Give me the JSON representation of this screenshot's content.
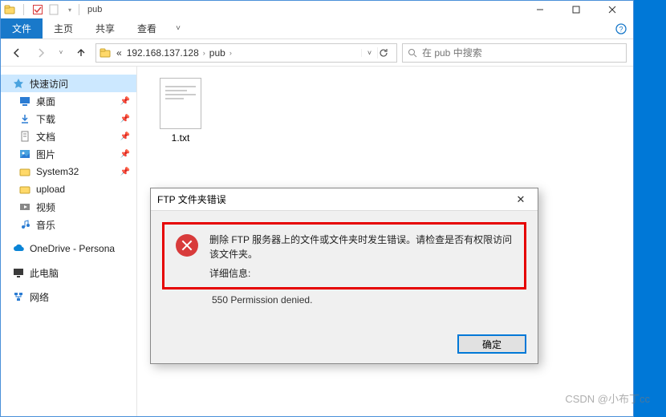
{
  "titlebar": {
    "title": "pub"
  },
  "ribbon": {
    "file": "文件",
    "home": "主页",
    "share": "共享",
    "view": "查看"
  },
  "address": {
    "seg1_prefix": "«",
    "seg1": "192.168.137.128",
    "seg2": "pub"
  },
  "search": {
    "placeholder": "在 pub 中搜索"
  },
  "sidebar": {
    "quick": "快速访问",
    "desktop": "桌面",
    "downloads": "下载",
    "documents": "文档",
    "pictures": "图片",
    "system32": "System32",
    "upload": "upload",
    "videos": "视频",
    "music": "音乐",
    "onedrive": "OneDrive - Persona",
    "thispc": "此电脑",
    "network": "网络"
  },
  "files": {
    "item1": "1.txt"
  },
  "dialog": {
    "title": "FTP 文件夹错误",
    "message": "删除 FTP 服务器上的文件或文件夹时发生错误。请检查是否有权限访问该文件夹。",
    "detail_label": "详细信息:",
    "detail": "550 Permission denied.",
    "ok": "确定"
  },
  "watermark": "CSDN @小布丁cc"
}
